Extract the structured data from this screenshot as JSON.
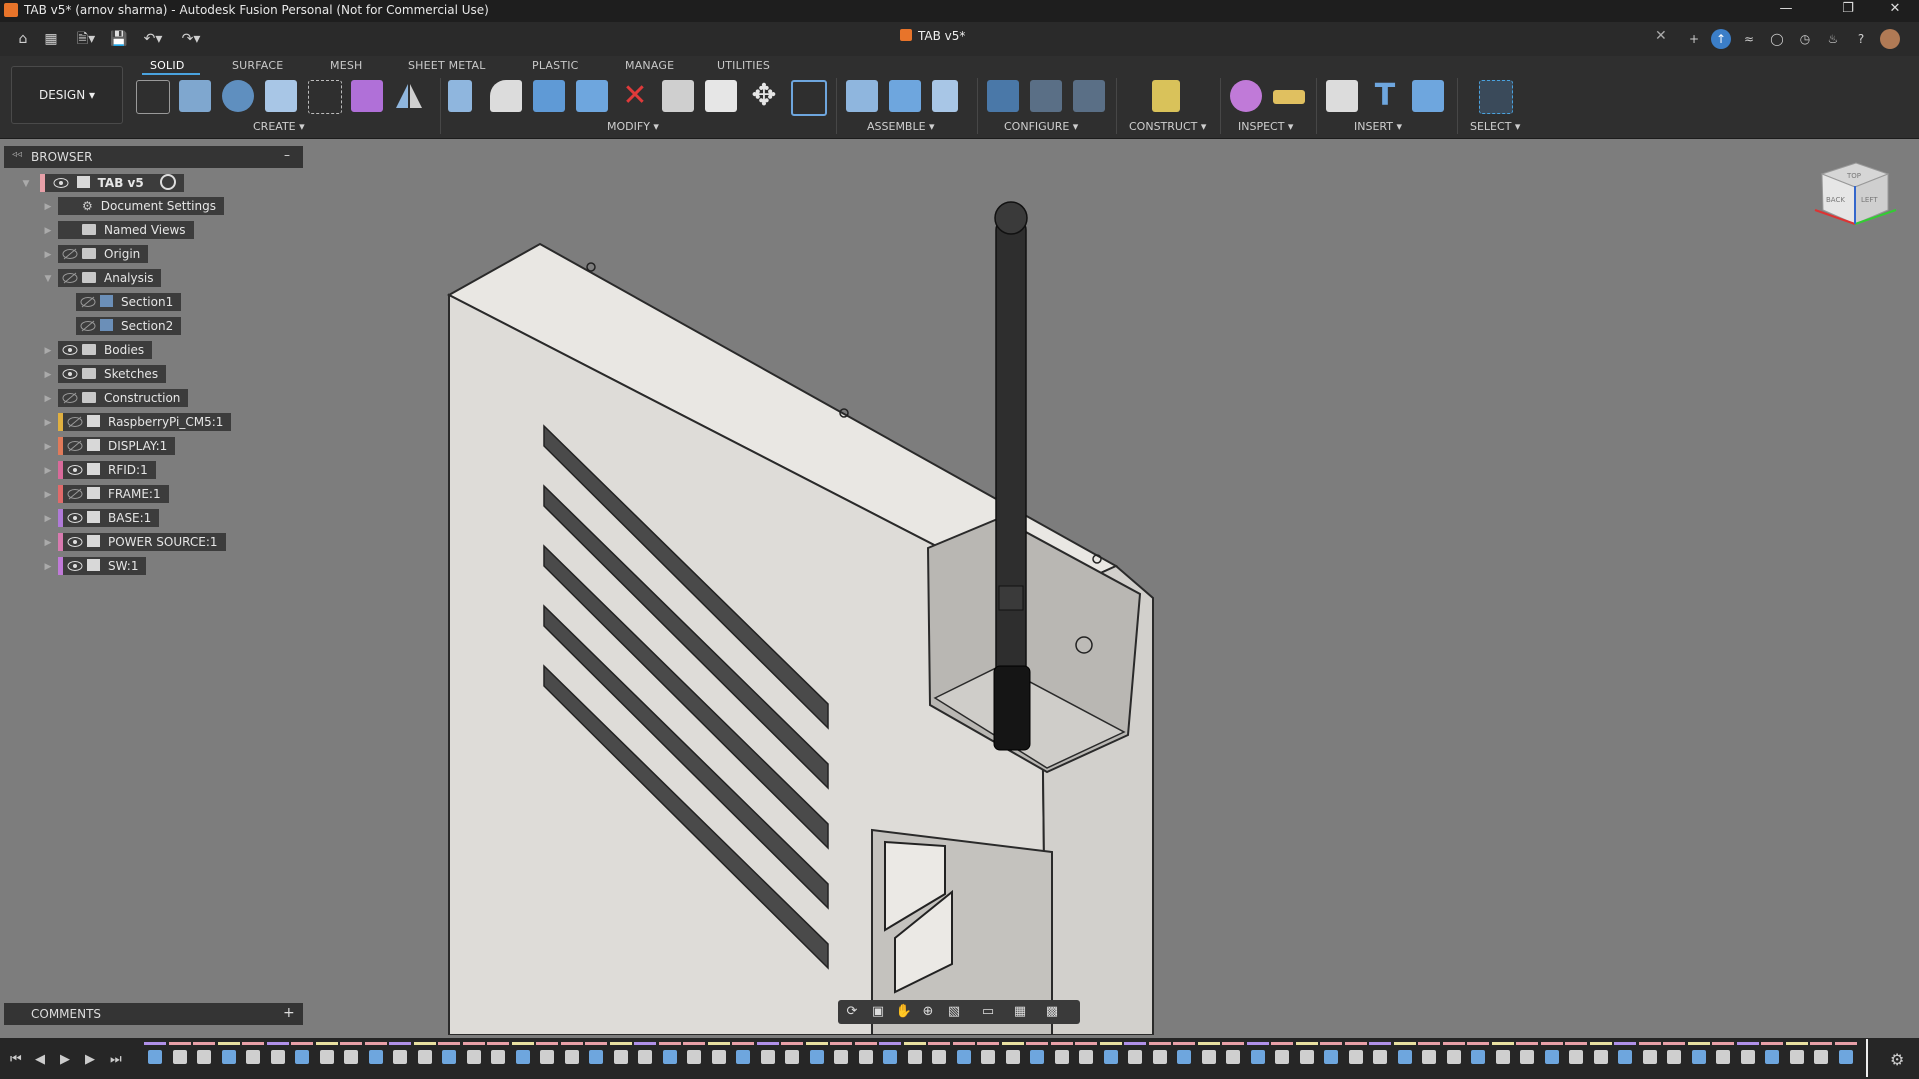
{
  "window": {
    "title": "TAB v5* (arnov sharma) - Autodesk Fusion Personal (Not for Commercial Use)",
    "controls": [
      "minimize-icon",
      "restore-icon",
      "close-icon"
    ]
  },
  "document_tab": {
    "label": "TAB v5*"
  },
  "workspace": {
    "label": "DESIGN ▾"
  },
  "ribbon": {
    "tabs": [
      {
        "label": "SOLID"
      },
      {
        "label": "SURFACE"
      },
      {
        "label": "MESH"
      },
      {
        "label": "SHEET METAL"
      },
      {
        "label": "PLASTIC"
      },
      {
        "label": "MANAGE"
      },
      {
        "label": "UTILITIES"
      }
    ],
    "groups": [
      {
        "label": "CREATE ▾"
      },
      {
        "label": "MODIFY ▾"
      },
      {
        "label": "ASSEMBLE ▾"
      },
      {
        "label": "CONFIGURE ▾"
      },
      {
        "label": "CONSTRUCT ▾"
      },
      {
        "label": "INSPECT ▾"
      },
      {
        "label": "INSERT ▾"
      },
      {
        "label": "SELECT ▾"
      }
    ]
  },
  "browser": {
    "title": "BROWSER",
    "root": "TAB v5",
    "items": [
      {
        "label": "Document Settings"
      },
      {
        "label": "Named Views"
      },
      {
        "label": "Origin"
      },
      {
        "label": "Analysis"
      },
      {
        "label": "Section1"
      },
      {
        "label": "Section2"
      },
      {
        "label": "Bodies"
      },
      {
        "label": "Sketches"
      },
      {
        "label": "Construction"
      },
      {
        "label": "RaspberryPi_CM5:1"
      },
      {
        "label": "DISPLAY:1"
      },
      {
        "label": "RFID:1"
      },
      {
        "label": "FRAME:1"
      },
      {
        "label": "BASE:1"
      },
      {
        "label": "POWER SOURCE:1"
      },
      {
        "label": "SW:1"
      }
    ]
  },
  "comments": {
    "title": "COMMENTS",
    "add": "+"
  },
  "viewcube": {
    "top": "TOP",
    "left": "BACK",
    "right": "LEFT"
  },
  "colors": {
    "accent": "#4aa3df",
    "viewport": "#7d7d7d",
    "ribbon": "#2f2f2f",
    "orange": "#e8742a"
  }
}
